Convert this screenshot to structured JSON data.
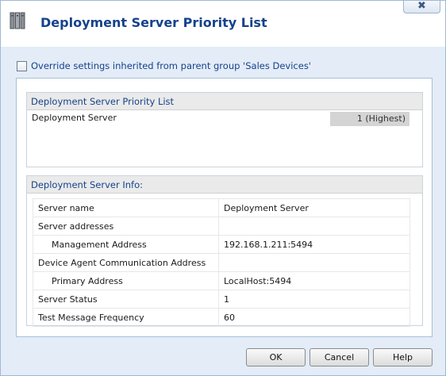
{
  "window": {
    "title": "Deployment Server Priority List",
    "close_glyph": "✖"
  },
  "override": {
    "label": "Override settings inherited from parent group 'Sales Devices'",
    "checked": false
  },
  "priority_list": {
    "header": "Deployment Server Priority List",
    "rows": [
      {
        "name": "Deployment Server",
        "priority": "1 (Highest)"
      }
    ]
  },
  "server_info": {
    "header": "Deployment Server Info:",
    "rows": [
      {
        "label": "Server name",
        "value": "Deployment Server"
      },
      {
        "label": "Server addresses",
        "value": ""
      },
      {
        "label": "Management Address",
        "value": "192.168.1.211:5494"
      },
      {
        "label": "Device Agent Communication Address",
        "value": ""
      },
      {
        "label": "Primary Address",
        "value": "LocalHost:5494"
      },
      {
        "label": "Server Status",
        "value": "1"
      },
      {
        "label": "Test Message Frequency",
        "value": "60"
      }
    ]
  },
  "buttons": {
    "ok": "OK",
    "cancel": "Cancel",
    "help": "Help"
  },
  "colors": {
    "title_text": "#15428b",
    "dialog_background": "#e3ecf7",
    "section_header_bg": "#eaeaea"
  }
}
